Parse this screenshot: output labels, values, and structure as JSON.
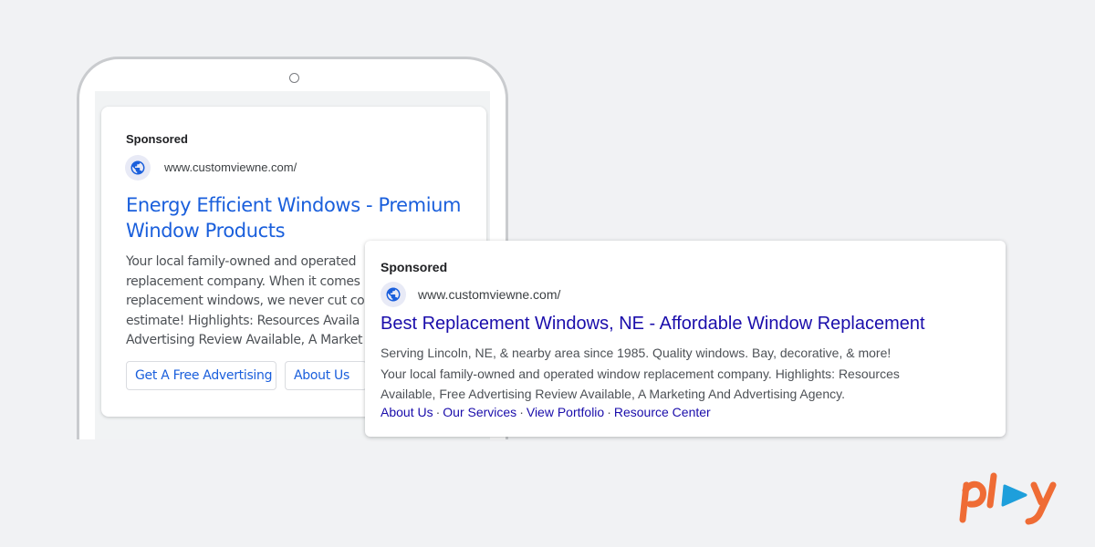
{
  "mobile_ad": {
    "sponsored": "Sponsored",
    "url": "www.customviewne.com/",
    "headline": "Energy Efficient Windows - Premium Window Products",
    "description_lines": [
      "Your local family-owned and operated",
      "replacement company. When it comes",
      "replacement windows, we never cut co",
      "estimate! Highlights: Resources Availa",
      "Advertising Review Available, A Market"
    ],
    "buttons": [
      "Get A Free Advertising",
      "About Us"
    ]
  },
  "desktop_ad": {
    "sponsored": "Sponsored",
    "url": "www.customviewne.com/",
    "headline": "Best Replacement Windows, NE - Affordable Window Replacement",
    "description_lines": [
      "Serving Lincoln, NE, & nearby area since 1985. Quality windows. Bay, decorative, & more!",
      "Your local family-owned and operated window replacement company. Highlights: Resources",
      "Available, Free Advertising Review Available, A Marketing And Advertising Agency."
    ],
    "sitelinks": [
      "About Us",
      "Our Services",
      "View Portfolio",
      "Resource Center"
    ],
    "sitelink_separator": "·"
  },
  "logo": {
    "text": "play",
    "colors": {
      "orange": "#ef6c35",
      "blue": "#1e9fdb"
    }
  },
  "colors": {
    "background": "#f1f2f4",
    "link_blue": "#1a0dab",
    "mobile_link_blue": "#1a5fdc"
  }
}
